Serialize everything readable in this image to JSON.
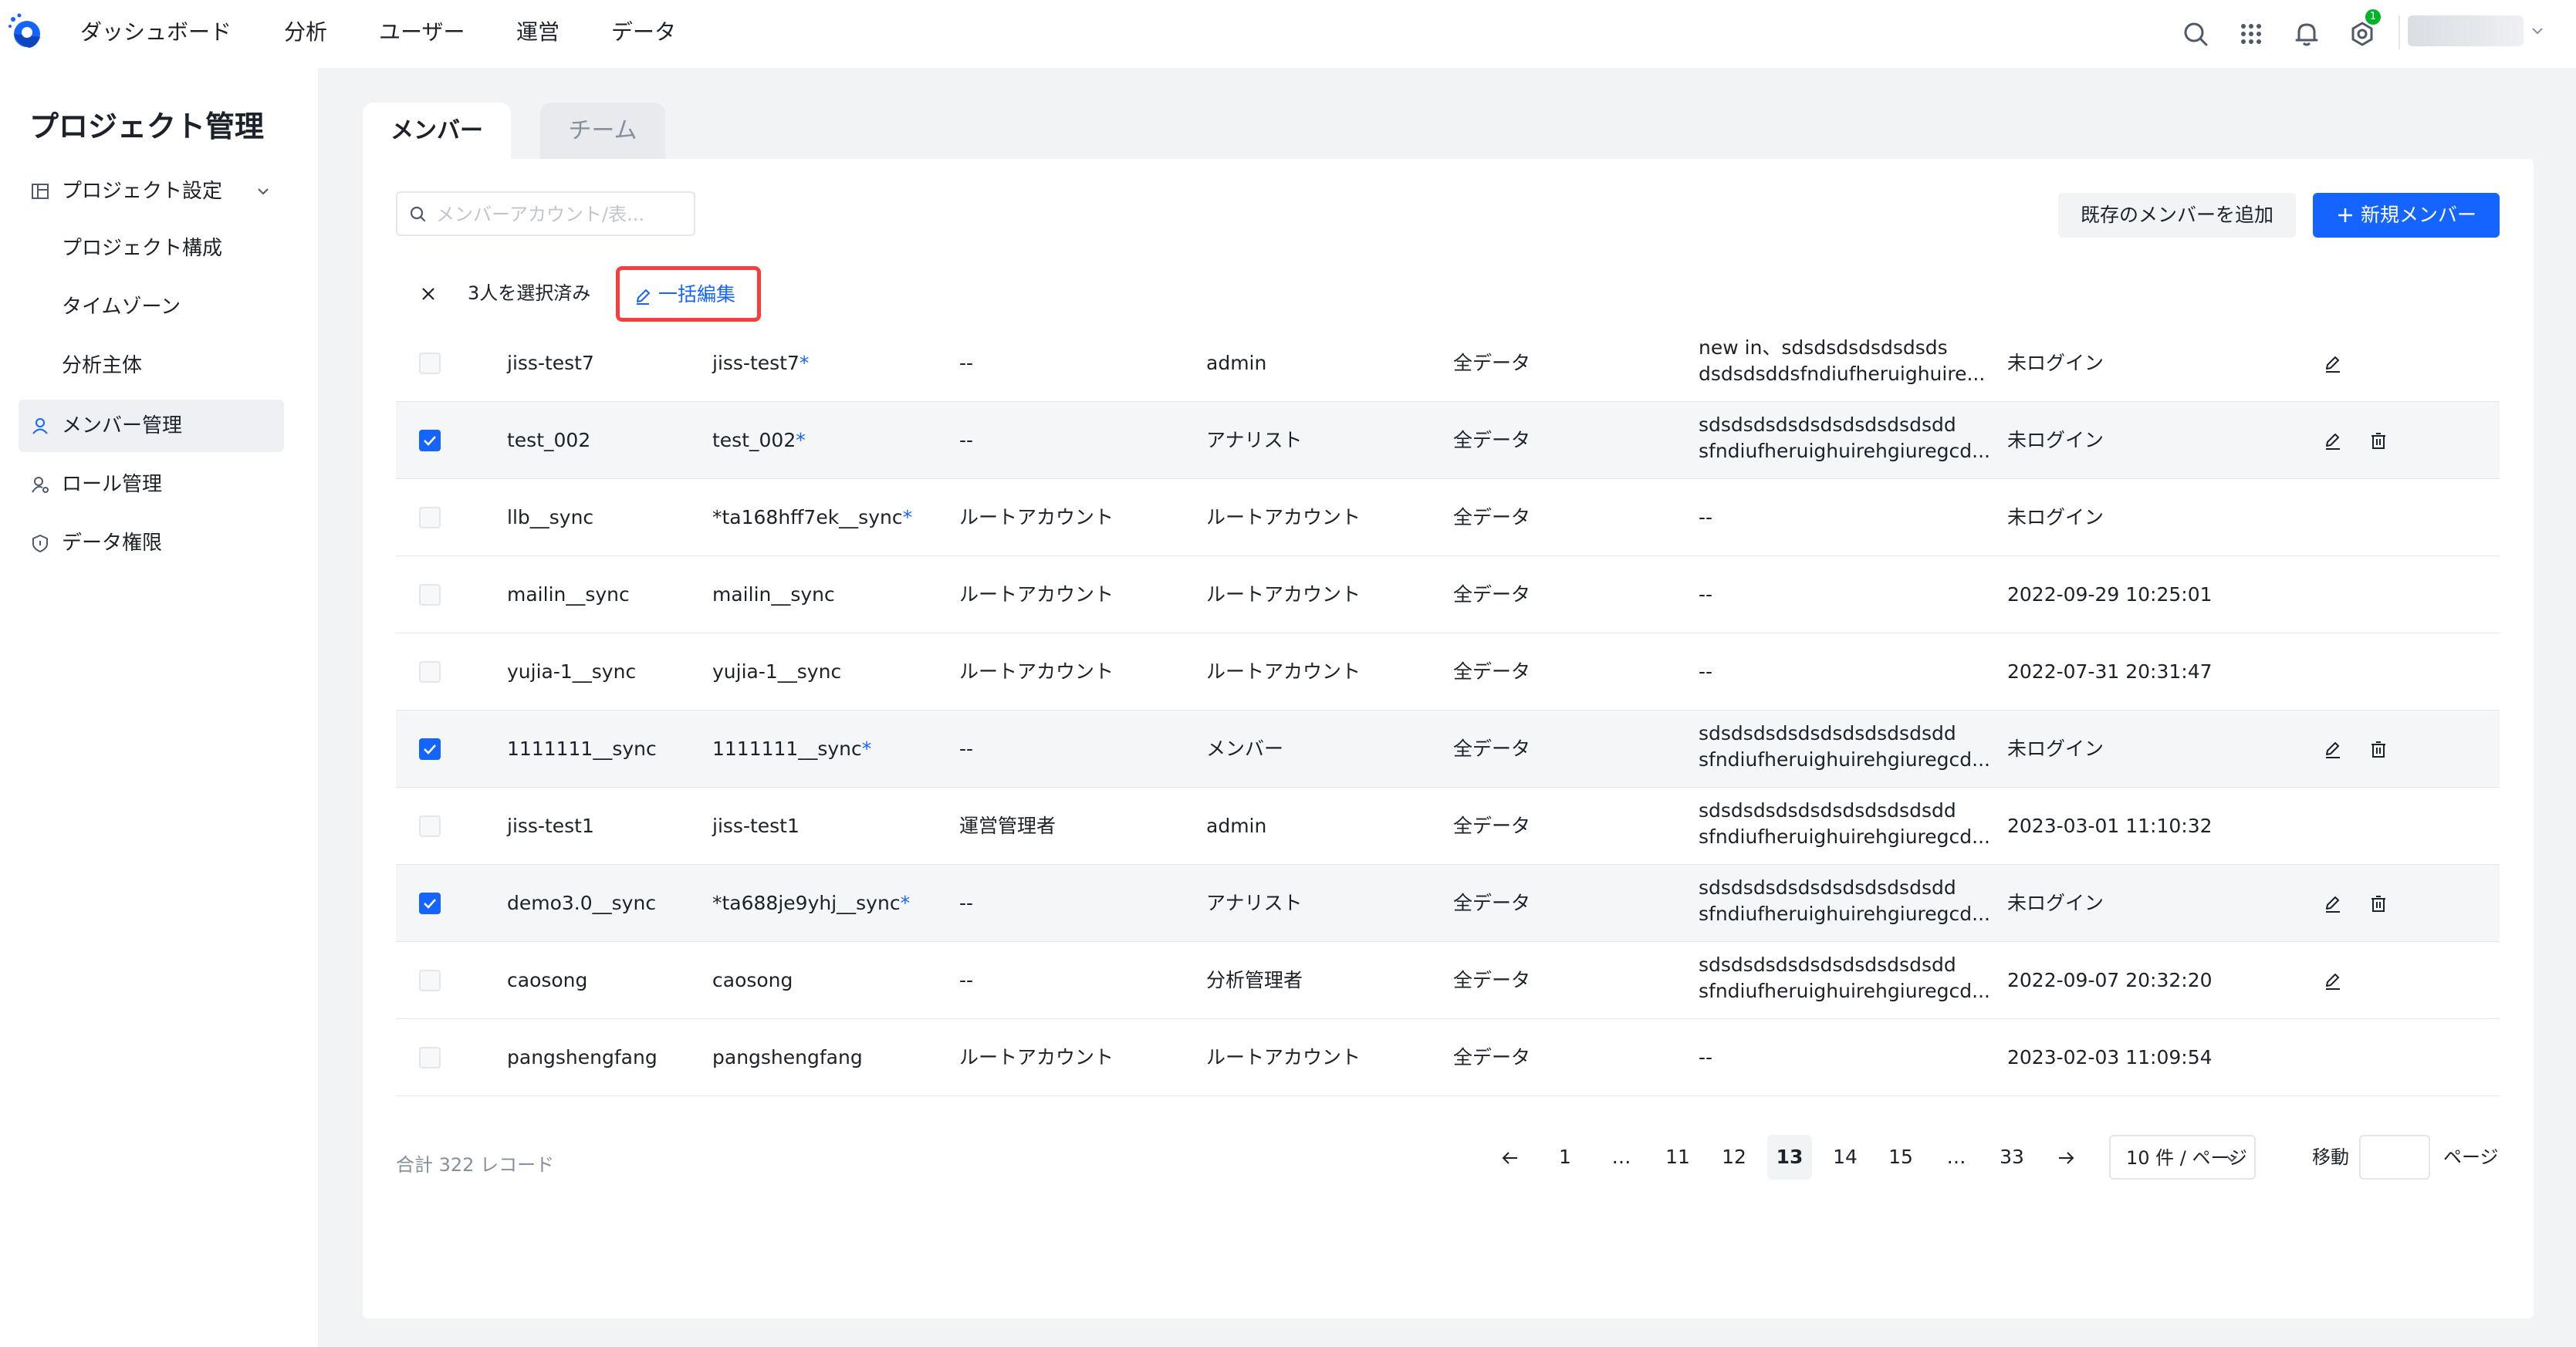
{
  "topbar": {
    "nav": [
      "ダッシュボード",
      "分析",
      "ユーザー",
      "運営",
      "データ"
    ],
    "notification_count": "1"
  },
  "sidebar": {
    "title": "プロジェクト管理",
    "items": [
      {
        "label": "プロジェクト設定",
        "icon": "layout-icon"
      },
      {
        "label": "メンバー管理",
        "icon": "user-icon"
      },
      {
        "label": "ロール管理",
        "icon": "role-icon"
      },
      {
        "label": "データ権限",
        "icon": "shield-icon"
      }
    ],
    "sub_items": [
      "プロジェクト構成",
      "タイムゾーン",
      "分析主体"
    ]
  },
  "tabs": [
    "メンバー",
    "チーム"
  ],
  "search": {
    "placeholder": "メンバーアカウント/表..."
  },
  "buttons": {
    "add_existing": "既存のメンバーを追加",
    "new_member": "新規メンバー"
  },
  "selection": {
    "count_text": "3人を選択済み",
    "bulk_edit": "一括編集"
  },
  "accent_color": "#1664ff",
  "table": {
    "rows": [
      {
        "checked": false,
        "name": "jiss-test7",
        "account": "jiss-test7",
        "account_star": true,
        "col3": "--",
        "role": "admin",
        "data": "全データ",
        "note_1": "new in、sdsdsdsdsdsdsds",
        "note_2": "dsdsdsddsfndiufheruighuire...",
        "login": "未ログイン",
        "edit": true,
        "delete": false
      },
      {
        "checked": true,
        "name": "test_002",
        "account": "test_002",
        "account_star": true,
        "col3": "--",
        "role": "アナリスト",
        "data": "全データ",
        "note_1": "sdsdsdsdsdsdsdsdsdsdsdd",
        "note_2": "sfndiufheruighuirehgiuregcd...",
        "login": "未ログイン",
        "edit": true,
        "delete": true
      },
      {
        "checked": false,
        "name": "llb__sync",
        "account": "*ta168hff7ek__sync",
        "account_star": true,
        "col3": "ルートアカウント",
        "role": "ルートアカウント",
        "data": "全データ",
        "note_1": "--",
        "note_2": "",
        "login": "未ログイン",
        "edit": false,
        "delete": false
      },
      {
        "checked": false,
        "name": "mailin__sync",
        "account": "mailin__sync",
        "account_star": false,
        "col3": "ルートアカウント",
        "role": "ルートアカウント",
        "data": "全データ",
        "note_1": "--",
        "note_2": "",
        "login": "2022-09-29 10:25:01",
        "edit": false,
        "delete": false
      },
      {
        "checked": false,
        "name": "yujia-1__sync",
        "account": "yujia-1__sync",
        "account_star": false,
        "col3": "ルートアカウント",
        "role": "ルートアカウント",
        "data": "全データ",
        "note_1": "--",
        "note_2": "",
        "login": "2022-07-31 20:31:47",
        "edit": false,
        "delete": false
      },
      {
        "checked": true,
        "name": "1111111__sync",
        "account": "1111111__sync",
        "account_star": true,
        "col3": "--",
        "role": "メンバー",
        "data": "全データ",
        "note_1": "sdsdsdsdsdsdsdsdsdsdsdd",
        "note_2": "sfndiufheruighuirehgiuregcd...",
        "login": "未ログイン",
        "edit": true,
        "delete": true
      },
      {
        "checked": false,
        "name": "jiss-test1",
        "account": "jiss-test1",
        "account_star": false,
        "col3": "運営管理者",
        "role": "admin",
        "data": "全データ",
        "note_1": "sdsdsdsdsdsdsdsdsdsdsdd",
        "note_2": "sfndiufheruighuirehgiuregcd...",
        "login": "2023-03-01 11:10:32",
        "edit": false,
        "delete": false
      },
      {
        "checked": true,
        "name": "demo3.0__sync",
        "account": "*ta688je9yhj__sync",
        "account_star": true,
        "col3": "--",
        "role": "アナリスト",
        "data": "全データ",
        "note_1": "sdsdsdsdsdsdsdsdsdsdsdd",
        "note_2": "sfndiufheruighuirehgiuregcd...",
        "login": "未ログイン",
        "edit": true,
        "delete": true
      },
      {
        "checked": false,
        "name": "caosong",
        "account": "caosong",
        "account_star": false,
        "col3": "--",
        "role": "分析管理者",
        "data": "全データ",
        "note_1": "sdsdsdsdsdsdsdsdsdsdsdd",
        "note_2": "sfndiufheruighuirehgiuregcd...",
        "login": "2022-09-07 20:32:20",
        "edit": true,
        "delete": false
      },
      {
        "checked": false,
        "name": "pangshengfang",
        "account": "pangshengfang",
        "account_star": false,
        "col3": "ルートアカウント",
        "role": "ルートアカウント",
        "data": "全データ",
        "note_1": "--",
        "note_2": "",
        "login": "2023-02-03 11:09:54",
        "edit": false,
        "delete": false
      }
    ]
  },
  "footer": {
    "total": "合計 322 レコード",
    "pages": [
      "1",
      "…",
      "11",
      "12",
      "13",
      "14",
      "15",
      "…",
      "33"
    ],
    "current_page": "13",
    "page_size": "10 件 / ページ",
    "goto_label": "移動",
    "goto_value": "",
    "page_unit": "ページ"
  }
}
